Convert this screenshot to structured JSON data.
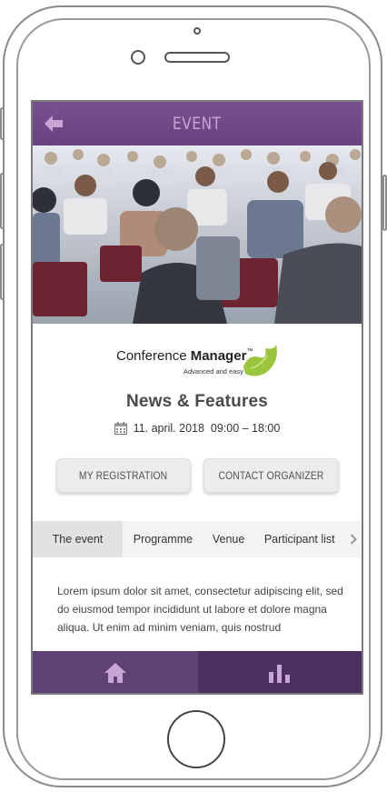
{
  "topbar": {
    "title": "EVENT",
    "back_icon": "arrow-left-icon"
  },
  "hero": {
    "description_icon": "conference-audience-photo"
  },
  "logo": {
    "name_regular": "Conference ",
    "name_bold": "Manager",
    "tm": "™",
    "tagline": "Advanced and easy"
  },
  "event": {
    "title": "News & Features",
    "date": "11. april. 2018  09:00 – 18:00",
    "date_icon": "calendar-icon"
  },
  "buttons": {
    "registration": "MY REGISTRATION",
    "contact": "CONTACT ORGANIZER"
  },
  "tabs": [
    {
      "label": "The event",
      "active": true
    },
    {
      "label": "Programme",
      "active": false
    },
    {
      "label": "Venue",
      "active": false
    },
    {
      "label": "Participant list",
      "active": false
    }
  ],
  "content": {
    "text": "Lorem ipsum dolor sit amet, consectetur adipiscing elit, sed do eiusmod tempor incididunt ut labore et dolore magna aliqua. Ut enim ad minim veniam, quis nostrud"
  },
  "bottom_nav": {
    "home_icon": "home-icon",
    "stats_icon": "bar-chart-icon"
  },
  "colors": {
    "primary": "#6a417e",
    "nav_active": "#5f4175",
    "nav_inactive": "#4a2f60",
    "accent_green": "#9bc53d"
  }
}
